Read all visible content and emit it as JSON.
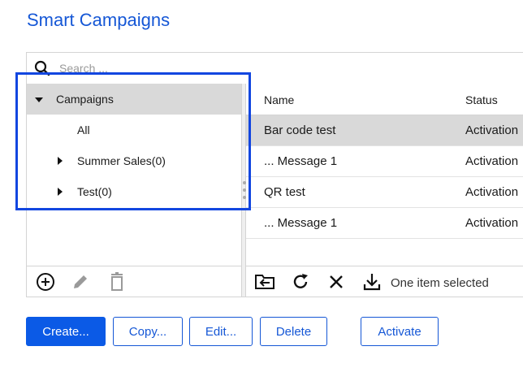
{
  "page_title": "Smart Campaigns",
  "search": {
    "placeholder": "Search ..."
  },
  "tree": {
    "root": {
      "label": "Campaigns",
      "expanded": true
    },
    "items": [
      {
        "label": "All"
      },
      {
        "label": "Summer Sales(0)"
      },
      {
        "label": "Test(0)"
      }
    ]
  },
  "tree_toolbar": {
    "icons": [
      "add-circle-icon",
      "pencil-icon",
      "trash-icon"
    ]
  },
  "grid": {
    "columns": [
      "Name",
      "Status"
    ],
    "rows": [
      {
        "name": "Bar code test",
        "status": "Activation",
        "selected": true
      },
      {
        "name": "... Message 1",
        "status": "Activation"
      },
      {
        "name": "QR test",
        "status": "Activation"
      },
      {
        "name": "... Message 1",
        "status": "Activation"
      }
    ]
  },
  "grid_toolbar": {
    "icons": [
      "move-to-folder-icon",
      "refresh-icon",
      "close-icon",
      "download-icon"
    ],
    "selection_text": "One item selected"
  },
  "buttons": {
    "create": "Create...",
    "copy": "Copy...",
    "edit": "Edit...",
    "delete": "Delete",
    "activate": "Activate"
  },
  "colors": {
    "accent": "#1557d6",
    "primary_button": "#0b5ae6",
    "highlight_box": "#1246e0",
    "selected_row": "#d9d9d9"
  }
}
